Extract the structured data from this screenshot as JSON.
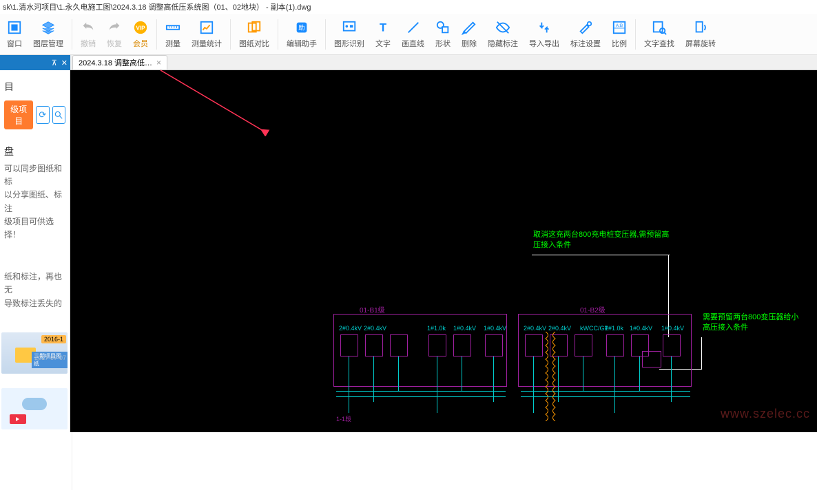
{
  "title_path": "sk\\1.清水河项目\\1.永久电施工图\\2024.3.18 调整高低压系统图（01、02地块） - 副本(1).dwg",
  "toolbar": {
    "window": "窗口",
    "layer": "图层管理",
    "undo": "撤销",
    "redo": "恢复",
    "vip": "会员",
    "measure": "测量",
    "measure_stat": "测量统计",
    "compare": "图纸对比",
    "edit_helper": "编辑助手",
    "shape_recog": "图形识别",
    "text": "文字",
    "draw_line": "画直线",
    "shape": "形状",
    "delete": "删除",
    "hide_annot": "隐藏标注",
    "import_export": "导入导出",
    "annot_settings": "标注设置",
    "scale": "比例",
    "text_search": "文字查找",
    "screen_rotate": "屏幕旋转"
  },
  "tab": {
    "name": "2024.3.18 调整高低…"
  },
  "panel": {
    "title": "目",
    "upgrade": "级项目",
    "sub": "盘",
    "desc1": "可以同步图纸和标",
    "desc2": "以分享图纸、标注",
    "desc3": "级项目可供选择！",
    "txt1": "纸和标注，再也无",
    "txt2": "导致标注丢失的",
    "tag": "2016-1",
    "tag2": "三期项目图纸",
    "date": "2017-07-07"
  },
  "drawing": {
    "note1_l1": "取消这充两台800充电桩变压器,需预留高",
    "note1_l2": "压接入条件",
    "note2_l1": "需要预留两台800变压器给小",
    "note2_l2": "高压接入条件",
    "label_left": "01-B1级",
    "label_right": "01-B2级"
  },
  "watermark": "www.szelec.cc"
}
